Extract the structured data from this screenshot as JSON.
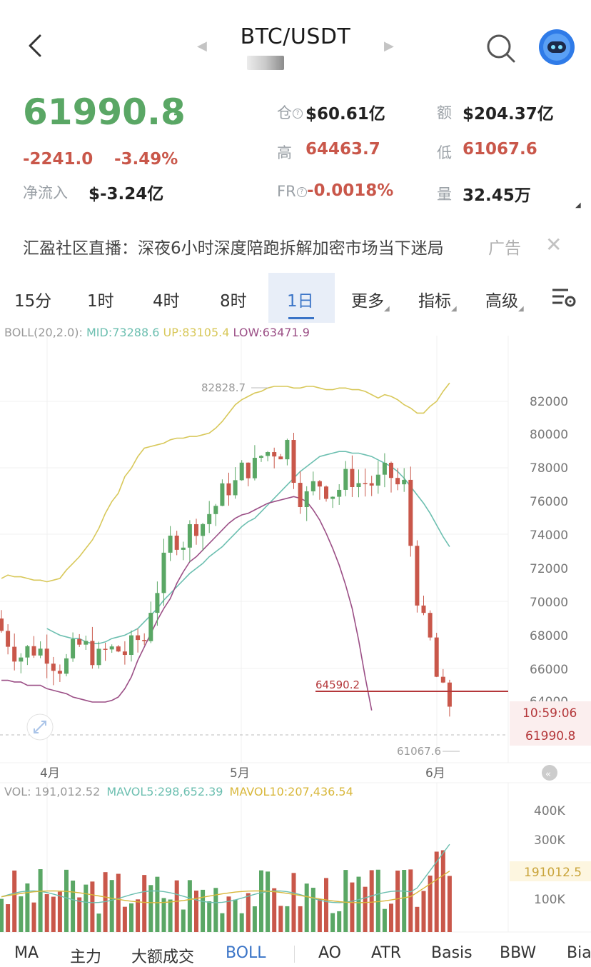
{
  "header": {
    "pair": "BTC/USDT",
    "back_icon": "chevron-left-icon",
    "search_icon": "search-icon",
    "avatar_icon": "robot-avatar-icon"
  },
  "ticker": {
    "price": "61990.8",
    "change": "-2241.0",
    "change_pct": "-3.49%",
    "net_inflow_label": "净流入",
    "net_inflow_value": "$-3.24亿",
    "oi_label": "仓",
    "oi_value": "$60.61亿",
    "amount_label": "额",
    "amount_value": "$204.37亿",
    "high_label": "高",
    "high_value": "64463.7",
    "low_label": "低",
    "low_value": "61067.6",
    "fr_label": "FR",
    "fr_value": "-0.0018%",
    "vol_label": "量",
    "vol_value": "32.45万"
  },
  "ad": {
    "text": "汇盈社区直播：深夜6小时深度陪跑拆解加密市场当下迷局",
    "tag": "广告"
  },
  "tabs": [
    "15分",
    "1时",
    "4时",
    "8时",
    "1日",
    "更多",
    "指标",
    "高级"
  ],
  "active_tab": "1日",
  "boll_legend": {
    "name": "BOLL(20,2.0):",
    "mid": "MID:73288.6",
    "up": "UP:83105.4",
    "low": "LOW:63471.9"
  },
  "vol_legend": {
    "vol": "VOL: 191,012.52",
    "mavol5": "MAVOL5:298,652.39",
    "mavol10": "MAVOL10:207,436.54"
  },
  "chart_labels": {
    "high_marker": "82828.7",
    "low_marker": "61067.6",
    "line_marker": "64590.2",
    "countdown": "10:59:06",
    "current_price": "61990.8",
    "vol_current": "191012.5"
  },
  "price_axis": [
    "82000",
    "80000",
    "78000",
    "76000",
    "74000",
    "72000",
    "70000",
    "68000",
    "66000",
    "64000"
  ],
  "vol_axis": [
    "400K",
    "300K",
    "100K"
  ],
  "date_axis": [
    "4月",
    "5月",
    "6月"
  ],
  "bottom_tabs": [
    "MA",
    "主力",
    "大额成交",
    "BOLL",
    "AO",
    "ATR",
    "Basis",
    "BBW",
    "Bias"
  ],
  "active_bottom_tab": "BOLL",
  "colors": {
    "up": "#5aa765",
    "down": "#c9574a",
    "boll_up": "#d8c85a",
    "boll_mid": "#6cbfb0",
    "boll_low": "#9b4f86",
    "active": "#3a74c7"
  },
  "chart_data": {
    "type": "candlestick",
    "title": "",
    "price_range": [
      60000,
      84000
    ],
    "volume_range": [
      0,
      450000
    ],
    "x_labels": [
      "4月",
      "5月",
      "6月"
    ],
    "series": [
      {
        "name": "BOLL UP",
        "values": [
          71400,
          71600,
          71500,
          71500,
          71400,
          71300,
          71300,
          71200,
          71300,
          71400,
          71900,
          72300,
          72700,
          73200,
          73700,
          74400,
          75300,
          76000,
          76500,
          77500,
          78000,
          78700,
          79200,
          79300,
          79400,
          79500,
          79700,
          79800,
          79800,
          79900,
          79900,
          80000,
          80100,
          80400,
          80800,
          81300,
          81800,
          82100,
          82300,
          82500,
          82600,
          82800,
          82900,
          82900,
          82900,
          82800,
          82800,
          82900,
          82900,
          82800,
          82700,
          82700,
          82800,
          82800,
          82700,
          82700,
          82600,
          82400,
          82200,
          82400,
          82300,
          82100,
          81800,
          81600,
          81300,
          81300,
          81700,
          82000,
          82600,
          83100
        ]
      },
      {
        "name": "BOLL MID",
        "values": [
          68400,
          68200,
          68000,
          67900,
          67800,
          67800,
          67600,
          67500,
          67500,
          67600,
          67800,
          67900,
          68000,
          68200,
          68400,
          68800,
          69200,
          69600,
          70100,
          70500,
          70900,
          71300,
          71700,
          72000,
          72300,
          72700,
          73000,
          73300,
          73700,
          74100,
          74500,
          74800,
          75000,
          75400,
          75800,
          76200,
          76600,
          77000,
          77400,
          77800,
          78100,
          78400,
          78700,
          78800,
          78900,
          79000,
          79000,
          78900,
          78900,
          78800,
          78700,
          78500,
          78300,
          78100,
          77800,
          77400,
          76900,
          76400,
          75900,
          75300,
          74600,
          73900,
          73300
        ]
      },
      {
        "name": "BOLL LOW",
        "values": [
          65300,
          65300,
          65200,
          65200,
          65000,
          65000,
          65000,
          64800,
          64700,
          64600,
          64500,
          64300,
          64200,
          64100,
          64000,
          64000,
          64000,
          64100,
          64300,
          64800,
          65500,
          66500,
          67300,
          68100,
          68900,
          69600,
          70200,
          71100,
          71800,
          72400,
          72700,
          73100,
          73500,
          73900,
          74300,
          74700,
          75000,
          75200,
          75300,
          75500,
          75700,
          75900,
          76000,
          76100,
          76200,
          76300,
          76200,
          76000,
          75500,
          74900,
          74100,
          73200,
          72200,
          71000,
          69600,
          67700,
          65500,
          63500
        ]
      },
      {
        "name": "VOL",
        "values": [
          191012
        ]
      },
      {
        "name": "MAVOL5",
        "values": [
          298652
        ]
      },
      {
        "name": "MAVOL10",
        "values": [
          207436
        ]
      }
    ]
  }
}
